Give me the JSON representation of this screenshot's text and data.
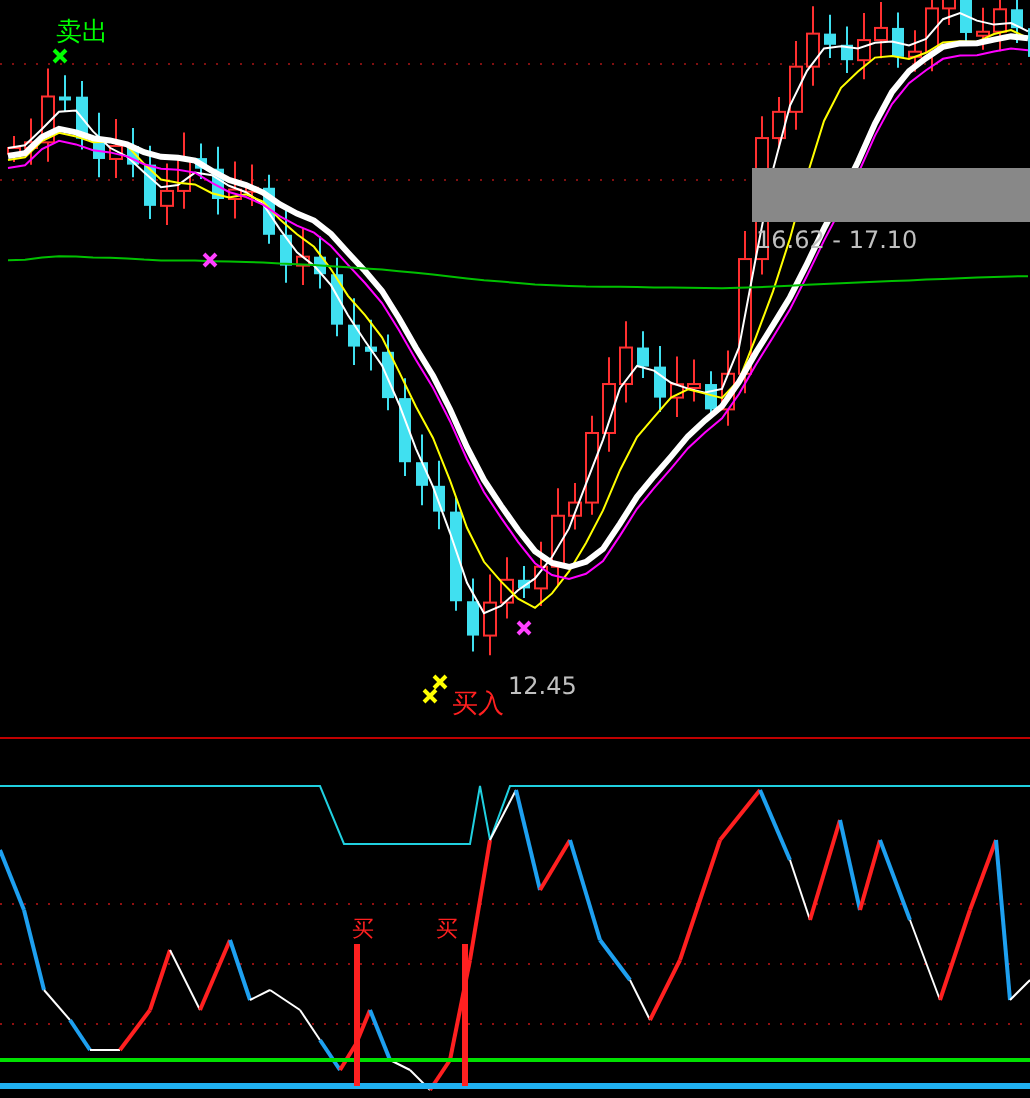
{
  "signals": [
    {
      "kind": "sell",
      "label": "卖出"
    },
    {
      "kind": "buy",
      "label": "买入"
    }
  ],
  "price_range": {
    "label": "16.62 - 17.10"
  },
  "low_price": {
    "label": "12.45"
  },
  "indicator_signals": [
    {
      "kind": "buy",
      "label": "买"
    },
    {
      "kind": "buy",
      "label": "买"
    }
  ]
}
